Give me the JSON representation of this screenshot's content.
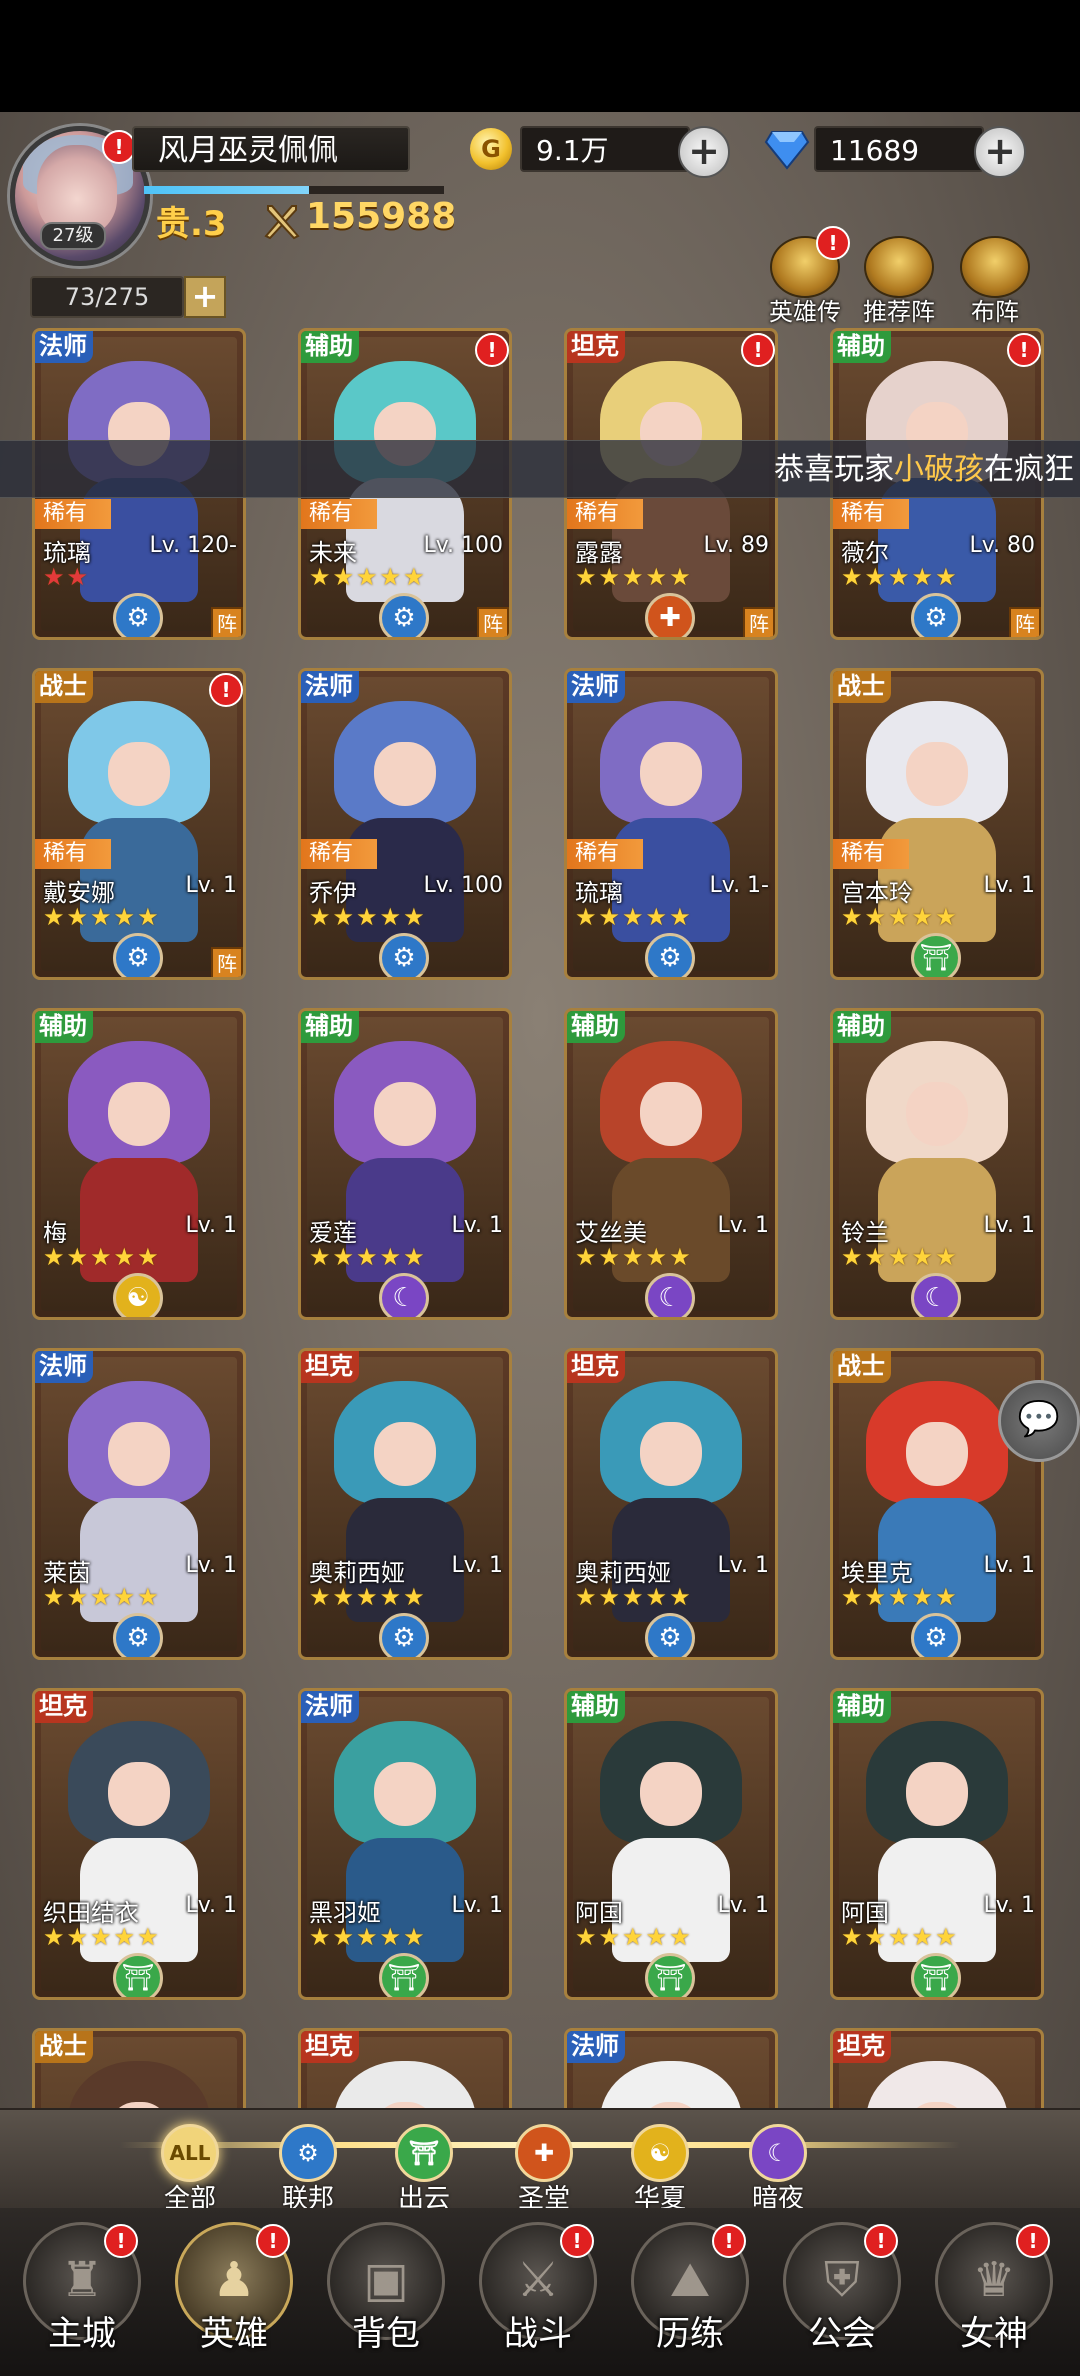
{
  "header": {
    "player_name": "风月巫灵佩佩",
    "level": "27级",
    "vip": "贵.3",
    "power": "155988",
    "gold": "9.1万",
    "gold_icon_letter": "G",
    "diamonds": "11689",
    "plus_label": "+",
    "alert": "!",
    "exp_progress_pct": 55
  },
  "hero_count": "73/275",
  "top_buttons": [
    {
      "label": "英雄传",
      "icon": "crown-icon",
      "badge": true
    },
    {
      "label": "推荐阵",
      "icon": "thumbs-up-icon",
      "badge": false
    },
    {
      "label": "布阵",
      "icon": "chess-knight-icon",
      "badge": false
    }
  ],
  "marquee": {
    "prefix": "恭喜玩家",
    "highlight": "小破孩",
    "suffix": "在疯狂"
  },
  "rare_label": "稀有",
  "formation_label": "阵",
  "heroes": [
    {
      "name": "琉璃",
      "level": "Lv. 120-",
      "cls": "法师",
      "rare": true,
      "stars": "★★",
      "red": true,
      "faction": "联邦",
      "zhen": true,
      "badge": false
    },
    {
      "name": "未来",
      "level": "Lv. 100",
      "cls": "辅助",
      "rare": true,
      "stars": "★★★★★",
      "faction": "联邦",
      "zhen": true,
      "badge": true
    },
    {
      "name": "露露",
      "level": "Lv. 89",
      "cls": "坦克",
      "rare": true,
      "stars": "★★★★★",
      "faction": "圣堂",
      "zhen": true,
      "badge": true
    },
    {
      "name": "薇尔",
      "level": "Lv. 80",
      "cls": "辅助",
      "rare": true,
      "stars": "★★★★★",
      "faction": "联邦",
      "zhen": true,
      "badge": true
    },
    {
      "name": "戴安娜",
      "level": "Lv. 1",
      "cls": "战士",
      "rare": true,
      "stars": "★★★★★",
      "faction": "联邦",
      "zhen": true,
      "badge": true
    },
    {
      "name": "乔伊",
      "level": "Lv. 100",
      "cls": "法师",
      "rare": true,
      "stars": "★★★★★",
      "faction": "联邦",
      "zhen": false,
      "badge": false
    },
    {
      "name": "琉璃",
      "level": "Lv. 1-",
      "cls": "法师",
      "rare": true,
      "stars": "★★★★★",
      "faction": "联邦",
      "zhen": false,
      "badge": false
    },
    {
      "name": "宫本玲",
      "level": "Lv. 1",
      "cls": "战士",
      "rare": true,
      "stars": "★★★★★",
      "faction": "出云",
      "zhen": false,
      "badge": false
    },
    {
      "name": "梅",
      "level": "Lv. 1",
      "cls": "辅助",
      "rare": false,
      "stars": "★★★★★",
      "faction": "华夏",
      "zhen": false,
      "badge": false
    },
    {
      "name": "爱莲",
      "level": "Lv. 1",
      "cls": "辅助",
      "rare": false,
      "stars": "★★★★★",
      "faction": "暗夜",
      "zhen": false,
      "badge": false
    },
    {
      "name": "艾丝美",
      "level": "Lv. 1",
      "cls": "辅助",
      "rare": false,
      "stars": "★★★★★",
      "faction": "暗夜",
      "zhen": false,
      "badge": false
    },
    {
      "name": "铃兰",
      "level": "Lv. 1",
      "cls": "辅助",
      "rare": false,
      "stars": "★★★★★",
      "faction": "暗夜",
      "zhen": false,
      "badge": false
    },
    {
      "name": "莱茵",
      "level": "Lv. 1",
      "cls": "法师",
      "rare": false,
      "stars": "★★★★★",
      "faction": "联邦",
      "zhen": false,
      "badge": false
    },
    {
      "name": "奥莉西娅",
      "level": "Lv. 1",
      "cls": "坦克",
      "rare": false,
      "stars": "★★★★★",
      "faction": "联邦",
      "zhen": false,
      "badge": false
    },
    {
      "name": "奥莉西娅",
      "level": "Lv. 1",
      "cls": "坦克",
      "rare": false,
      "stars": "★★★★★",
      "faction": "联邦",
      "zhen": false,
      "badge": false
    },
    {
      "name": "埃里克",
      "level": "Lv. 1",
      "cls": "战士",
      "rare": false,
      "stars": "★★★★★",
      "faction": "联邦",
      "zhen": false,
      "badge": false
    },
    {
      "name": "织田结衣",
      "level": "Lv. 1",
      "cls": "坦克",
      "rare": false,
      "stars": "★★★★★",
      "faction": "出云",
      "zhen": false,
      "badge": false
    },
    {
      "name": "黑羽姬",
      "level": "Lv. 1",
      "cls": "法师",
      "rare": false,
      "stars": "★★★★★",
      "faction": "出云",
      "zhen": false,
      "badge": false
    },
    {
      "name": "阿国",
      "level": "Lv. 1",
      "cls": "辅助",
      "rare": false,
      "stars": "★★★★★",
      "faction": "出云",
      "zhen": false,
      "badge": false
    },
    {
      "name": "阿国",
      "level": "Lv. 1",
      "cls": "辅助",
      "rare": false,
      "stars": "★★★★★",
      "faction": "出云",
      "zhen": false,
      "badge": false
    },
    {
      "name": "",
      "level": "",
      "cls": "战士",
      "rare": false,
      "stars": "",
      "faction": "",
      "zhen": false,
      "badge": false
    },
    {
      "name": "",
      "level": "",
      "cls": "坦克",
      "rare": false,
      "stars": "",
      "faction": "",
      "zhen": false,
      "badge": false
    },
    {
      "name": "",
      "level": "",
      "cls": "法师",
      "rare": false,
      "stars": "",
      "faction": "",
      "zhen": false,
      "badge": false
    },
    {
      "name": "",
      "level": "",
      "cls": "坦克",
      "rare": false,
      "stars": "",
      "faction": "",
      "zhen": false,
      "badge": false
    }
  ],
  "faction_filters": [
    {
      "label": "全部",
      "icon_text": "ALL",
      "color": "#f1d47a",
      "selected": true
    },
    {
      "label": "联邦",
      "icon_text": "⚙",
      "color": "#2e78c8"
    },
    {
      "label": "出云",
      "icon_text": "⛩",
      "color": "#3aa84a"
    },
    {
      "label": "圣堂",
      "icon_text": "✚",
      "color": "#d0541c"
    },
    {
      "label": "华夏",
      "icon_text": "☯",
      "color": "#e2b21c"
    },
    {
      "label": "暗夜",
      "icon_text": "☾",
      "color": "#7a46c4"
    }
  ],
  "bottom_nav": [
    {
      "label": "主城",
      "icon": "castle-icon",
      "glyph": "♜",
      "badge": true
    },
    {
      "label": "英雄",
      "icon": "hooded-hero-icon",
      "glyph": "♟",
      "badge": true,
      "active": true
    },
    {
      "label": "背包",
      "icon": "backpack-icon",
      "glyph": "▣",
      "badge": false
    },
    {
      "label": "战斗",
      "icon": "crossed-swords-icon",
      "glyph": "⚔",
      "badge": true
    },
    {
      "label": "历练",
      "icon": "map-icon",
      "glyph": "⛰",
      "badge": true
    },
    {
      "label": "公会",
      "icon": "shield-icon",
      "glyph": "⛨",
      "badge": true
    },
    {
      "label": "女神",
      "icon": "goddess-icon",
      "glyph": "♛",
      "badge": true
    }
  ],
  "class_colors": {
    "法师": "#2a5fb8",
    "辅助": "#2e9a3c",
    "坦克": "#b7351f",
    "战士": "#b8741a"
  },
  "faction_colors": {
    "联邦": "#2e78c8",
    "出云": "#3aa84a",
    "圣堂": "#d0541c",
    "华夏": "#e2b21c",
    "暗夜": "#7a46c4"
  },
  "faction_glyphs": {
    "联邦": "⚙",
    "出云": "⛩",
    "圣堂": "✚",
    "华夏": "☯",
    "暗夜": "☾"
  },
  "chat_icon": "chat-bubble-icon"
}
